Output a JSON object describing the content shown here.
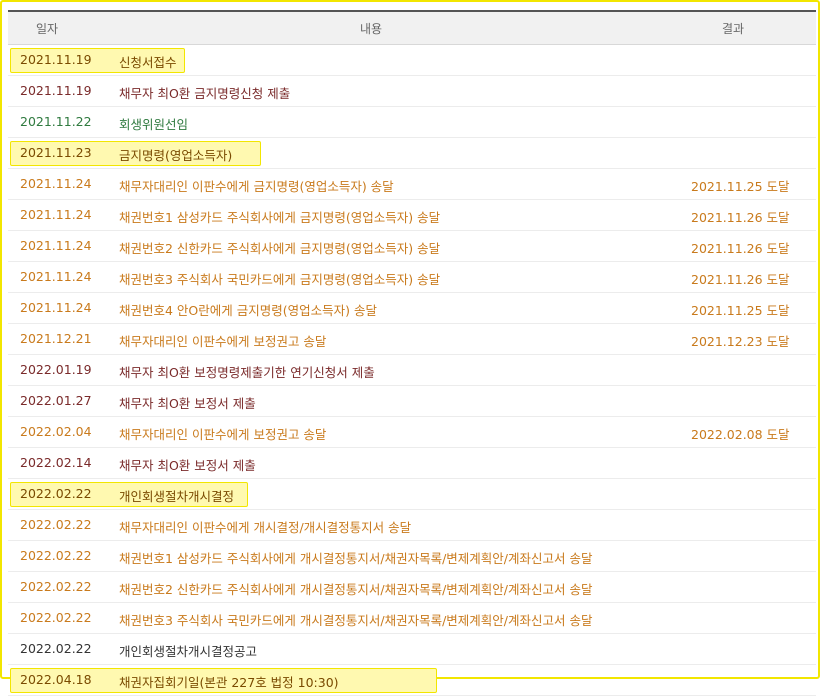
{
  "header": {
    "date": "일자",
    "content": "내용",
    "result": "결과"
  },
  "rows": [
    {
      "date": "2021.11.19",
      "content": "신청서접수",
      "result": "",
      "style": "hl"
    },
    {
      "date": "2021.11.19",
      "content": "채무자 최O환 금지명령신청 제출",
      "result": "",
      "style": "maroon"
    },
    {
      "date": "2021.11.22",
      "content": "회생위원선임",
      "result": "",
      "style": "green"
    },
    {
      "date": "2021.11.23",
      "content": "금지명령(영업소득자)",
      "result": "",
      "style": "hl"
    },
    {
      "date": "2021.11.24",
      "content": "채무자대리인 이판수에게 금지명령(영업소득자) 송달",
      "result": "2021.11.25 도달",
      "style": "orange"
    },
    {
      "date": "2021.11.24",
      "content": "채권번호1 삼성카드 주식회사에게 금지명령(영업소득자) 송달",
      "result": "2021.11.26 도달",
      "style": "orange"
    },
    {
      "date": "2021.11.24",
      "content": "채권번호2 신한카드 주식회사에게 금지명령(영업소득자) 송달",
      "result": "2021.11.26 도달",
      "style": "orange"
    },
    {
      "date": "2021.11.24",
      "content": "채권번호3 주식회사 국민카드에게 금지명령(영업소득자) 송달",
      "result": "2021.11.26 도달",
      "style": "orange"
    },
    {
      "date": "2021.11.24",
      "content": "채권번호4 안O란에게 금지명령(영업소득자) 송달",
      "result": "2021.11.25 도달",
      "style": "orange"
    },
    {
      "date": "2021.12.21",
      "content": "채무자대리인 이판수에게 보정권고 송달",
      "result": "2021.12.23 도달",
      "style": "orange"
    },
    {
      "date": "2022.01.19",
      "content": "채무자 최O환 보정명령제출기한 연기신청서 제출",
      "result": "",
      "style": "maroon"
    },
    {
      "date": "2022.01.27",
      "content": "채무자 최O환 보정서 제출",
      "result": "",
      "style": "maroon"
    },
    {
      "date": "2022.02.04",
      "content": "채무자대리인 이판수에게 보정권고 송달",
      "result": "2022.02.08 도달",
      "style": "orange"
    },
    {
      "date": "2022.02.14",
      "content": "채무자 최O환 보정서 제출",
      "result": "",
      "style": "maroon"
    },
    {
      "date": "2022.02.22",
      "content": "개인회생절차개시결정",
      "result": "",
      "style": "hl"
    },
    {
      "date": "2022.02.22",
      "content": "채무자대리인 이판수에게 개시결정/개시결정통지서 송달",
      "result": "",
      "style": "orange"
    },
    {
      "date": "2022.02.22",
      "content": "채권번호1 삼성카드 주식회사에게 개시결정통지서/채권자목록/변제계획안/계좌신고서 송달",
      "result": "",
      "style": "orange"
    },
    {
      "date": "2022.02.22",
      "content": "채권번호2 신한카드 주식회사에게 개시결정통지서/채권자목록/변제계획안/계좌신고서 송달",
      "result": "",
      "style": "orange"
    },
    {
      "date": "2022.02.22",
      "content": "채권번호3 주식회사 국민카드에게 개시결정통지서/채권자목록/변제계획안/계좌신고서 송달",
      "result": "",
      "style": "orange"
    },
    {
      "date": "2022.02.22",
      "content": "개인회생절차개시결정공고",
      "result": "",
      "style": "dark"
    },
    {
      "date": "2022.04.18",
      "content": "채권자집회기일(본관 227호 법정 10:30)",
      "result": "",
      "style": "hl"
    }
  ]
}
